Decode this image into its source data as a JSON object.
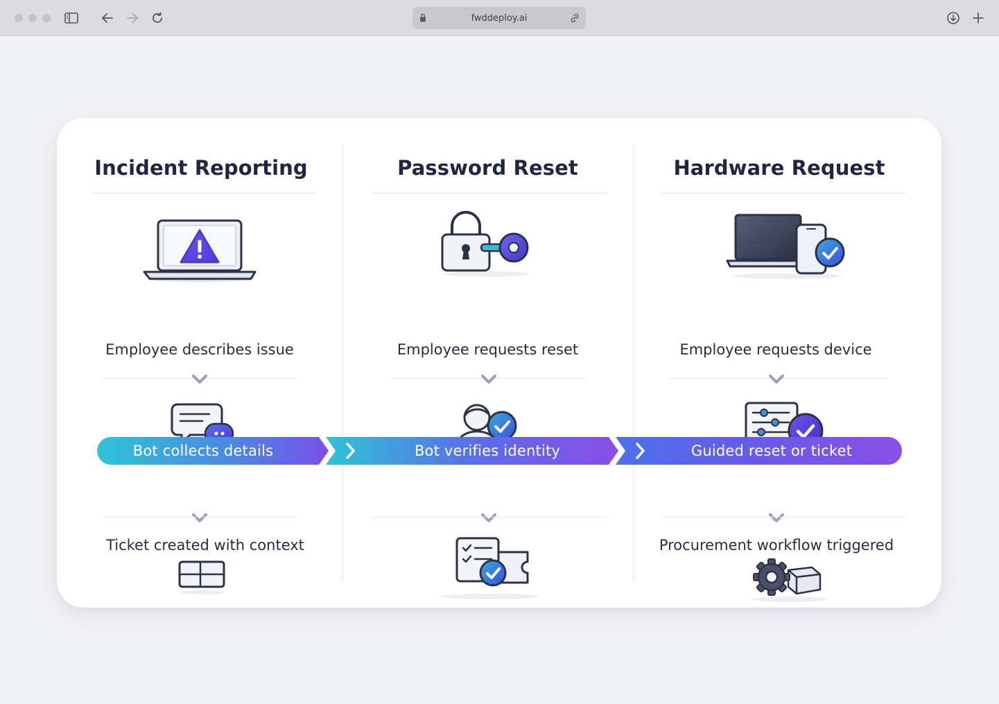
{
  "browser": {
    "url": "fwddeploy.ai"
  },
  "diagram": {
    "columns": [
      {
        "title": "Incident Reporting",
        "trigger": "Employee describes issue",
        "result": "Ticket created with context",
        "icons": [
          "laptop-warning-icon",
          "chat-bubbles-icon",
          "ticket-icon"
        ]
      },
      {
        "title": "Password Reset",
        "trigger": "Employee requests reset",
        "result": "",
        "icons": [
          "padlock-key-icon",
          "user-verified-icon",
          "checklist-ticket-icon"
        ]
      },
      {
        "title": "Hardware Request",
        "trigger": "Employee requests device",
        "result": "Procurement workflow triggered",
        "icons": [
          "laptop-phone-check-icon",
          "settings-panel-check-icon",
          "gear-box-icon"
        ]
      }
    ],
    "banner": [
      "Bot collects details",
      "Bot verifies identity",
      "Guided reset or ticket"
    ],
    "colors": {
      "gradient_start": "#2ec4d6",
      "gradient_mid": "#5a6ee8",
      "gradient_end": "#8a4de6",
      "title_text": "#1f2640",
      "check_badge": "#4b5fe0"
    }
  }
}
